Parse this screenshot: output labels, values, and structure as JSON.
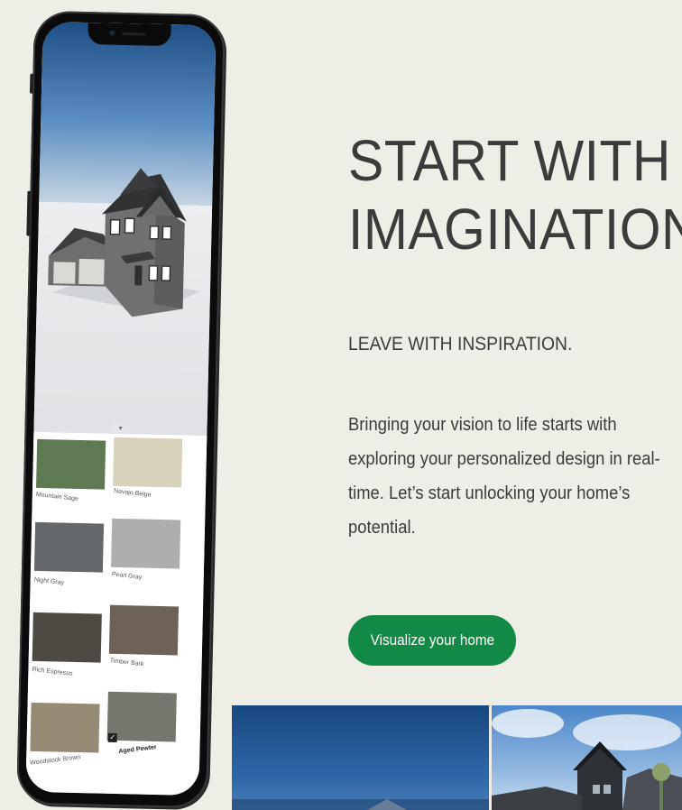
{
  "hero": {
    "headline_line1": "START WITH",
    "headline_line2": "IMAGINATION",
    "subheadline": "LEAVE WITH INSPIRATION.",
    "body": "Bringing your vision to life starts with exploring your personalized design in real-time. Let’s start unlocking your home’s potential.",
    "cta_label": "Visualize your home",
    "cta_color": "#128a45"
  },
  "phone": {
    "swatches": [
      {
        "name": "Mountain Sage",
        "color": "#5f7a52"
      },
      {
        "name": "Navajo Beige",
        "color": "#d8d2bd"
      },
      {
        "name": "Night Gray",
        "color": "#64676b"
      },
      {
        "name": "Pearl Gray",
        "color": "#aeaeac"
      },
      {
        "name": "Rich Espresso",
        "color": "#4f4944"
      },
      {
        "name": "Timber Bark",
        "color": "#6c6256"
      },
      {
        "name": "Woodstock Brown",
        "color": "#958a74"
      },
      {
        "name": "Aged Pewter",
        "color": "#75776f",
        "selected": true
      }
    ]
  },
  "icons": {
    "handle": "chevron-down-icon",
    "selected": "checkmark-icon"
  }
}
